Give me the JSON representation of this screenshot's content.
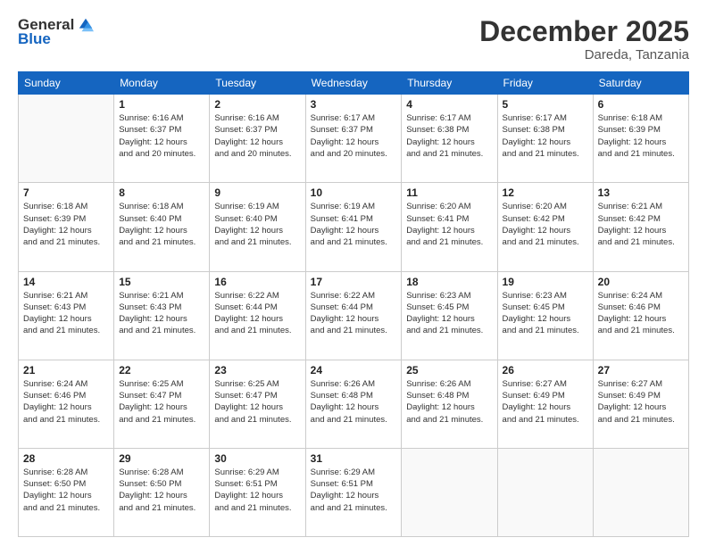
{
  "logo": {
    "general": "General",
    "blue": "Blue"
  },
  "header": {
    "month": "December 2025",
    "location": "Dareda, Tanzania"
  },
  "weekdays": [
    "Sunday",
    "Monday",
    "Tuesday",
    "Wednesday",
    "Thursday",
    "Friday",
    "Saturday"
  ],
  "weeks": [
    [
      {
        "day": "",
        "sunrise": "",
        "sunset": "",
        "daylight": ""
      },
      {
        "day": "1",
        "sunrise": "Sunrise: 6:16 AM",
        "sunset": "Sunset: 6:37 PM",
        "daylight": "Daylight: 12 hours and 20 minutes."
      },
      {
        "day": "2",
        "sunrise": "Sunrise: 6:16 AM",
        "sunset": "Sunset: 6:37 PM",
        "daylight": "Daylight: 12 hours and 20 minutes."
      },
      {
        "day": "3",
        "sunrise": "Sunrise: 6:17 AM",
        "sunset": "Sunset: 6:37 PM",
        "daylight": "Daylight: 12 hours and 20 minutes."
      },
      {
        "day": "4",
        "sunrise": "Sunrise: 6:17 AM",
        "sunset": "Sunset: 6:38 PM",
        "daylight": "Daylight: 12 hours and 21 minutes."
      },
      {
        "day": "5",
        "sunrise": "Sunrise: 6:17 AM",
        "sunset": "Sunset: 6:38 PM",
        "daylight": "Daylight: 12 hours and 21 minutes."
      },
      {
        "day": "6",
        "sunrise": "Sunrise: 6:18 AM",
        "sunset": "Sunset: 6:39 PM",
        "daylight": "Daylight: 12 hours and 21 minutes."
      }
    ],
    [
      {
        "day": "7",
        "sunrise": "Sunrise: 6:18 AM",
        "sunset": "Sunset: 6:39 PM",
        "daylight": "Daylight: 12 hours and 21 minutes."
      },
      {
        "day": "8",
        "sunrise": "Sunrise: 6:18 AM",
        "sunset": "Sunset: 6:40 PM",
        "daylight": "Daylight: 12 hours and 21 minutes."
      },
      {
        "day": "9",
        "sunrise": "Sunrise: 6:19 AM",
        "sunset": "Sunset: 6:40 PM",
        "daylight": "Daylight: 12 hours and 21 minutes."
      },
      {
        "day": "10",
        "sunrise": "Sunrise: 6:19 AM",
        "sunset": "Sunset: 6:41 PM",
        "daylight": "Daylight: 12 hours and 21 minutes."
      },
      {
        "day": "11",
        "sunrise": "Sunrise: 6:20 AM",
        "sunset": "Sunset: 6:41 PM",
        "daylight": "Daylight: 12 hours and 21 minutes."
      },
      {
        "day": "12",
        "sunrise": "Sunrise: 6:20 AM",
        "sunset": "Sunset: 6:42 PM",
        "daylight": "Daylight: 12 hours and 21 minutes."
      },
      {
        "day": "13",
        "sunrise": "Sunrise: 6:21 AM",
        "sunset": "Sunset: 6:42 PM",
        "daylight": "Daylight: 12 hours and 21 minutes."
      }
    ],
    [
      {
        "day": "14",
        "sunrise": "Sunrise: 6:21 AM",
        "sunset": "Sunset: 6:43 PM",
        "daylight": "Daylight: 12 hours and 21 minutes."
      },
      {
        "day": "15",
        "sunrise": "Sunrise: 6:21 AM",
        "sunset": "Sunset: 6:43 PM",
        "daylight": "Daylight: 12 hours and 21 minutes."
      },
      {
        "day": "16",
        "sunrise": "Sunrise: 6:22 AM",
        "sunset": "Sunset: 6:44 PM",
        "daylight": "Daylight: 12 hours and 21 minutes."
      },
      {
        "day": "17",
        "sunrise": "Sunrise: 6:22 AM",
        "sunset": "Sunset: 6:44 PM",
        "daylight": "Daylight: 12 hours and 21 minutes."
      },
      {
        "day": "18",
        "sunrise": "Sunrise: 6:23 AM",
        "sunset": "Sunset: 6:45 PM",
        "daylight": "Daylight: 12 hours and 21 minutes."
      },
      {
        "day": "19",
        "sunrise": "Sunrise: 6:23 AM",
        "sunset": "Sunset: 6:45 PM",
        "daylight": "Daylight: 12 hours and 21 minutes."
      },
      {
        "day": "20",
        "sunrise": "Sunrise: 6:24 AM",
        "sunset": "Sunset: 6:46 PM",
        "daylight": "Daylight: 12 hours and 21 minutes."
      }
    ],
    [
      {
        "day": "21",
        "sunrise": "Sunrise: 6:24 AM",
        "sunset": "Sunset: 6:46 PM",
        "daylight": "Daylight: 12 hours and 21 minutes."
      },
      {
        "day": "22",
        "sunrise": "Sunrise: 6:25 AM",
        "sunset": "Sunset: 6:47 PM",
        "daylight": "Daylight: 12 hours and 21 minutes."
      },
      {
        "day": "23",
        "sunrise": "Sunrise: 6:25 AM",
        "sunset": "Sunset: 6:47 PM",
        "daylight": "Daylight: 12 hours and 21 minutes."
      },
      {
        "day": "24",
        "sunrise": "Sunrise: 6:26 AM",
        "sunset": "Sunset: 6:48 PM",
        "daylight": "Daylight: 12 hours and 21 minutes."
      },
      {
        "day": "25",
        "sunrise": "Sunrise: 6:26 AM",
        "sunset": "Sunset: 6:48 PM",
        "daylight": "Daylight: 12 hours and 21 minutes."
      },
      {
        "day": "26",
        "sunrise": "Sunrise: 6:27 AM",
        "sunset": "Sunset: 6:49 PM",
        "daylight": "Daylight: 12 hours and 21 minutes."
      },
      {
        "day": "27",
        "sunrise": "Sunrise: 6:27 AM",
        "sunset": "Sunset: 6:49 PM",
        "daylight": "Daylight: 12 hours and 21 minutes."
      }
    ],
    [
      {
        "day": "28",
        "sunrise": "Sunrise: 6:28 AM",
        "sunset": "Sunset: 6:50 PM",
        "daylight": "Daylight: 12 hours and 21 minutes."
      },
      {
        "day": "29",
        "sunrise": "Sunrise: 6:28 AM",
        "sunset": "Sunset: 6:50 PM",
        "daylight": "Daylight: 12 hours and 21 minutes."
      },
      {
        "day": "30",
        "sunrise": "Sunrise: 6:29 AM",
        "sunset": "Sunset: 6:51 PM",
        "daylight": "Daylight: 12 hours and 21 minutes."
      },
      {
        "day": "31",
        "sunrise": "Sunrise: 6:29 AM",
        "sunset": "Sunset: 6:51 PM",
        "daylight": "Daylight: 12 hours and 21 minutes."
      },
      {
        "day": "",
        "sunrise": "",
        "sunset": "",
        "daylight": ""
      },
      {
        "day": "",
        "sunrise": "",
        "sunset": "",
        "daylight": ""
      },
      {
        "day": "",
        "sunrise": "",
        "sunset": "",
        "daylight": ""
      }
    ]
  ]
}
